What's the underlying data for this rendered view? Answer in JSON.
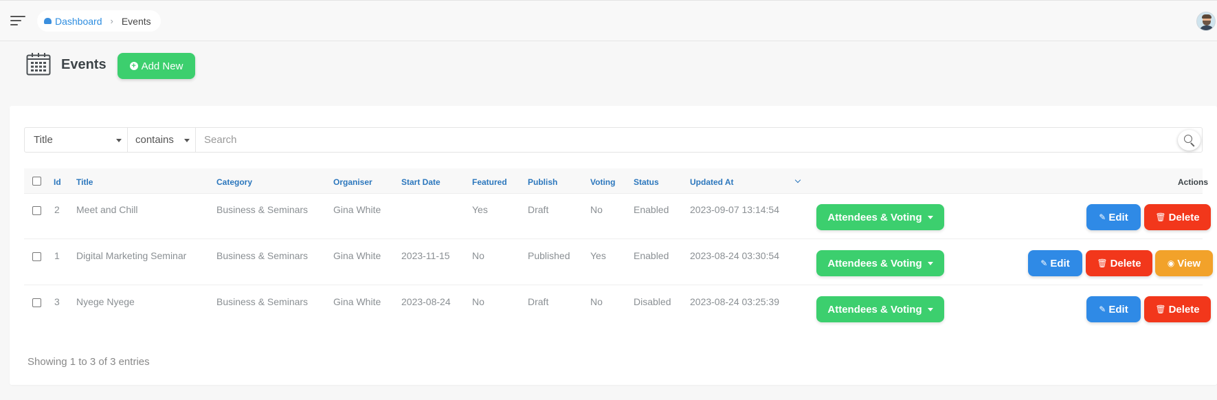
{
  "header": {
    "breadcrumb": {
      "home": "Dashboard",
      "separator": "›",
      "current": "Events"
    }
  },
  "page": {
    "title": "Events",
    "add_button": "Add New"
  },
  "filter": {
    "field": "Title",
    "operator": "contains",
    "search_placeholder": "Search"
  },
  "table": {
    "columns": {
      "id": "Id",
      "title": "Title",
      "category": "Category",
      "organiser": "Organiser",
      "start_date": "Start Date",
      "featured": "Featured",
      "publish": "Publish",
      "voting": "Voting",
      "status": "Status",
      "updated_at": "Updated At",
      "actions": "Actions"
    },
    "rows": [
      {
        "id": "2",
        "title": "Meet and Chill",
        "category": "Business & Seminars",
        "organiser": "Gina White",
        "start_date": "",
        "featured": "Yes",
        "publish": "Draft",
        "voting": "No",
        "status": "Enabled",
        "updated_at": "2023-09-07 13:14:54"
      },
      {
        "id": "1",
        "title": "Digital Marketing Seminar",
        "category": "Business & Seminars",
        "organiser": "Gina White",
        "start_date": "2023-11-15",
        "featured": "No",
        "publish": "Published",
        "voting": "Yes",
        "status": "Enabled",
        "updated_at": "2023-08-24 03:30:54"
      },
      {
        "id": "3",
        "title": "Nyege Nyege",
        "category": "Business & Seminars",
        "organiser": "Gina White",
        "start_date": "2023-08-24",
        "featured": "No",
        "publish": "Draft",
        "voting": "No",
        "status": "Disabled",
        "updated_at": "2023-08-24 03:25:39"
      }
    ],
    "buttons": {
      "attendees": "Attendees & Voting",
      "edit": "Edit",
      "delete": "Delete",
      "view": "View"
    }
  },
  "footer": {
    "info": "Showing 1 to 3 of 3 entries"
  },
  "colors": {
    "accent": "#2c77bd",
    "success": "#3ccf6e",
    "edit": "#2f8ae6",
    "delete": "#f2371b",
    "view": "#f2a22a"
  }
}
